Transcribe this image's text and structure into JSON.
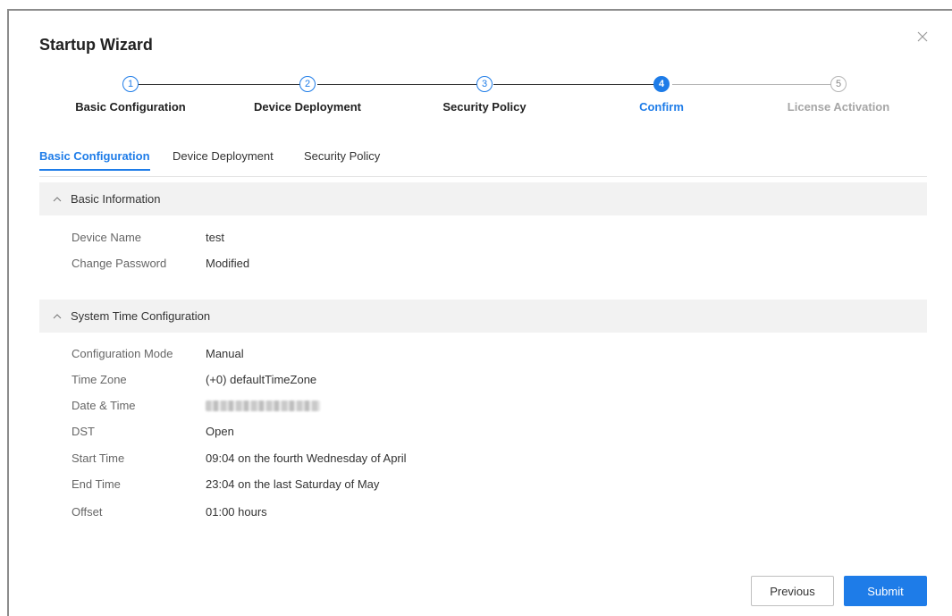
{
  "dialog": {
    "title": "Startup Wizard"
  },
  "steps": [
    {
      "number": "1",
      "label": "Basic Configuration",
      "state": "done"
    },
    {
      "number": "2",
      "label": "Device Deployment",
      "state": "done"
    },
    {
      "number": "3",
      "label": "Security Policy",
      "state": "done"
    },
    {
      "number": "4",
      "label": "Confirm",
      "state": "active"
    },
    {
      "number": "5",
      "label": "License Activation",
      "state": "pending"
    }
  ],
  "tabs": [
    {
      "label": "Basic Configuration",
      "active": true
    },
    {
      "label": "Device Deployment",
      "active": false
    },
    {
      "label": "Security Policy",
      "active": false
    }
  ],
  "basic_information": {
    "title": "Basic Information",
    "rows": [
      {
        "key": "Device Name",
        "value": "test"
      },
      {
        "key": "Change Password",
        "value": "Modified"
      }
    ]
  },
  "system_time": {
    "title": "System Time Configuration",
    "rows": [
      {
        "key": "Configuration Mode",
        "value": "Manual"
      },
      {
        "key": "Time Zone",
        "value": "(+0) defaultTimeZone"
      },
      {
        "key": "Date & Time",
        "value": ""
      },
      {
        "key": "DST",
        "value": "Open"
      },
      {
        "key": "Start Time",
        "value": "09:04 on the fourth Wednesday of April"
      },
      {
        "key": "End Time",
        "value": "23:04 on the last Saturday of May"
      },
      {
        "key": "Offset",
        "value": "01:00 hours"
      }
    ]
  },
  "buttons": {
    "previous": "Previous",
    "submit": "Submit"
  },
  "colors": {
    "accent": "#1e7ce8",
    "pending": "#b5b5b5",
    "section_bg": "#f2f2f2"
  }
}
